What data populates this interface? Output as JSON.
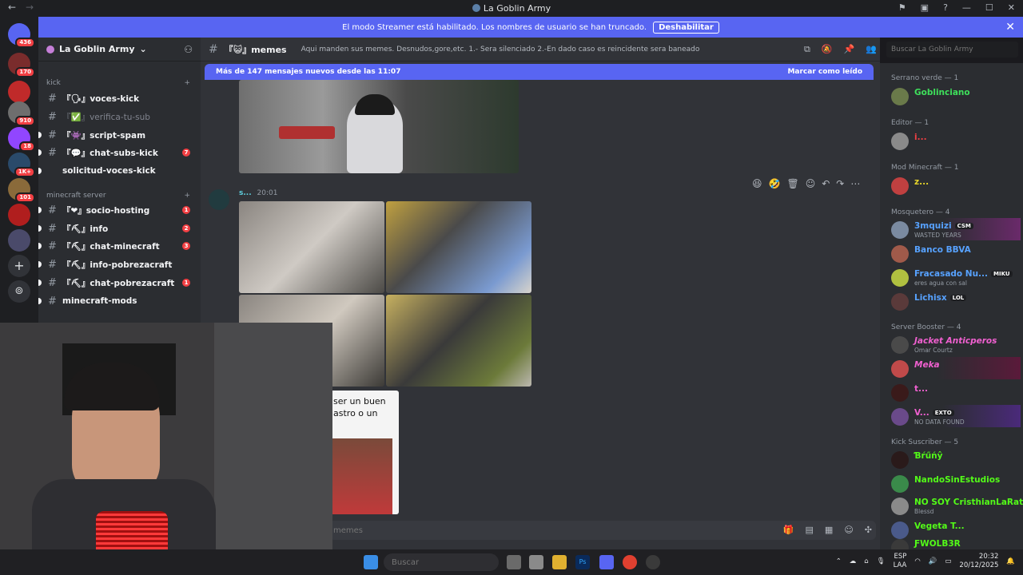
{
  "window": {
    "title": "La Goblin Army",
    "back": "←",
    "forward": "→"
  },
  "banner": {
    "text": "El modo Streamer está habilitado. Los nombres de usuario se han truncado.",
    "button": "Deshabilitar",
    "close": "✕"
  },
  "server_rail": {
    "badges": [
      "436",
      "170",
      "910",
      "18",
      "1K+",
      "101"
    ]
  },
  "guild": {
    "name": "La Goblin Army",
    "chevron": "⌄"
  },
  "channels": {
    "category_kick": "kick",
    "category_minecraft": "minecraft server",
    "items": [
      {
        "name": "『🗣』voces-kick",
        "badge": ""
      },
      {
        "name": "『✅』verifica-tu-sub",
        "badge": ""
      },
      {
        "name": "『👾』script-spam",
        "badge": ""
      },
      {
        "name": "『💬』chat-subs-kick",
        "badge": "7"
      },
      {
        "name": "solicitud-voces-kick",
        "badge": ""
      },
      {
        "name": "『❤』socio-hosting",
        "badge": "1"
      },
      {
        "name": "『⛏』info",
        "badge": "2"
      },
      {
        "name": "『⛏』chat-minecraft",
        "badge": "3"
      },
      {
        "name": "『⛏』info-pobrezacraft",
        "badge": ""
      },
      {
        "name": "『⛏』chat-pobrezacraft",
        "badge": "1"
      },
      {
        "name": "minecraft-mods",
        "badge": ""
      }
    ]
  },
  "channel_header": {
    "name": "『😺』memes",
    "topic": "Aqui manden sus memes. Desnudos,gore,etc. 1.- Sera silenciado 2.-En dado caso es reincidente sera baneado",
    "search_placeholder": "Buscar La Goblin Army"
  },
  "new_messages": {
    "text": "Más de 147 mensajes nuevos desde las 11:07",
    "mark_read": "Marcar como leído"
  },
  "message": {
    "author": "s...",
    "time": "20:01"
  },
  "partial_text": {
    "line1": "ser un buen",
    "line2": "astro o un"
  },
  "composer": {
    "placeholder": "memes"
  },
  "members": {
    "categories": [
      {
        "label": "Serrano verde — 1"
      },
      {
        "label": "Editor — 1"
      },
      {
        "label": "Mod Minecraft — 1"
      },
      {
        "label": "Mosquetero — 4"
      },
      {
        "label": "Server Booster — 4"
      },
      {
        "label": "Kick Suscriber — 5"
      }
    ],
    "list": [
      {
        "name": "Goblinciano",
        "sub": "",
        "tag": "",
        "color": "#3ee05b"
      },
      {
        "name": "i...",
        "sub": "",
        "tag": "",
        "color": "#f23f43"
      },
      {
        "name": "z...",
        "sub": "",
        "tag": "",
        "color": "#e6d42a"
      },
      {
        "name": "3mquizi",
        "sub": "WASTED YEARS",
        "tag": "CSM",
        "color": "#57a2ff"
      },
      {
        "name": "Banco BBVA",
        "sub": "",
        "tag": "",
        "color": "#57a2ff"
      },
      {
        "name": "Fracasado Nu...",
        "sub": "eres agua con sal",
        "tag": "MIKU",
        "color": "#57a2ff"
      },
      {
        "name": "Lichisx",
        "sub": "",
        "tag": "LOL",
        "color": "#57a2ff"
      },
      {
        "name": "Jacket Anticperos",
        "sub": "Omar Courtz",
        "tag": "",
        "color": "#f060d0"
      },
      {
        "name": "Meka",
        "sub": "",
        "tag": "",
        "color": "#f060d0"
      },
      {
        "name": "t...",
        "sub": "",
        "tag": "",
        "color": "#f060d0"
      },
      {
        "name": "V...",
        "sub": "NO DATA FOUND",
        "tag": "EXTO",
        "color": "#f060d0"
      },
      {
        "name": "Ɓŕűńŷ",
        "sub": "",
        "tag": "",
        "color": "#53fc18"
      },
      {
        "name": "NandoSinEstudios",
        "sub": "",
        "tag": "",
        "color": "#53fc18"
      },
      {
        "name": "NO SOY CristhianLaRata",
        "sub": "Blessd",
        "tag": "",
        "color": "#53fc18"
      },
      {
        "name": "Vegeta T...",
        "sub": "",
        "tag": "",
        "color": "#53fc18"
      },
      {
        "name": "ƑWOLB3R",
        "sub": "",
        "tag": "",
        "color": "#53fc18"
      }
    ]
  },
  "taskbar": {
    "search": "Buscar",
    "lang": "ESP",
    "lang2": "LAA",
    "time": "20:32",
    "date": "20/12/2025"
  }
}
